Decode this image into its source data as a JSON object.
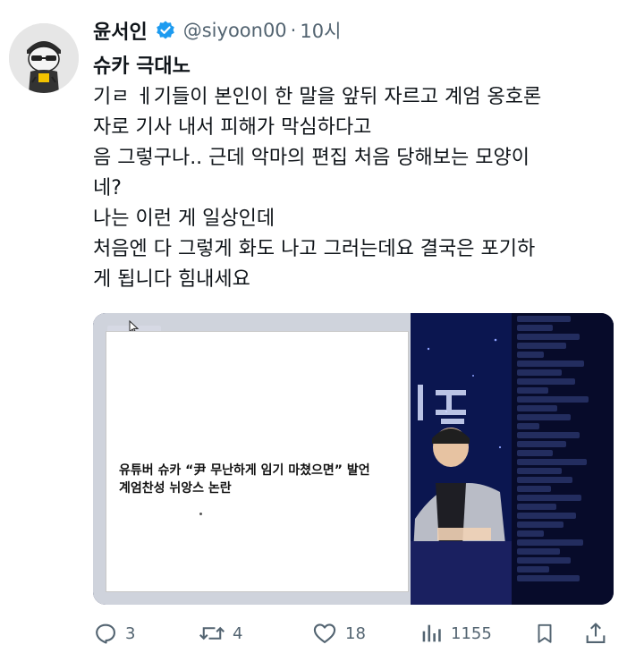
{
  "tweet": {
    "author_name": "윤서인",
    "handle": "@siyoon00",
    "separator": "·",
    "time": "10시",
    "title_line": "슈카 극대노",
    "body_lines": [
      "기ㄹ ㅔ기들이 본인이 한 말을 앞뒤 자르고 계엄 옹호론",
      "자로 기사 내서 피해가 막심하다고",
      "음 그렇구나.. 근데 악마의 편집 처음 당해보는 모양이",
      "네?",
      "나는 이런 게 일상인데",
      "처음엔 다 그렇게 화도 나고 그러는데요 결국은 포기하",
      "게 됩니다 힘내세요"
    ]
  },
  "media": {
    "caption": "유튜버 슈카 “尹 무난하게 임기 마쳤으면” 발언\n계엄찬성 뉘앙스 논란"
  },
  "actions": {
    "replies": "3",
    "retweets": "4",
    "likes": "18",
    "views": "1155"
  },
  "colors": {
    "text": "#0f1419",
    "muted": "#536471",
    "verified": "#1d9bf0"
  },
  "icons": [
    "avatar-character",
    "verified-badge-icon",
    "reply-icon",
    "retweet-icon",
    "like-icon",
    "views-icon",
    "bookmark-icon",
    "share-icon"
  ]
}
